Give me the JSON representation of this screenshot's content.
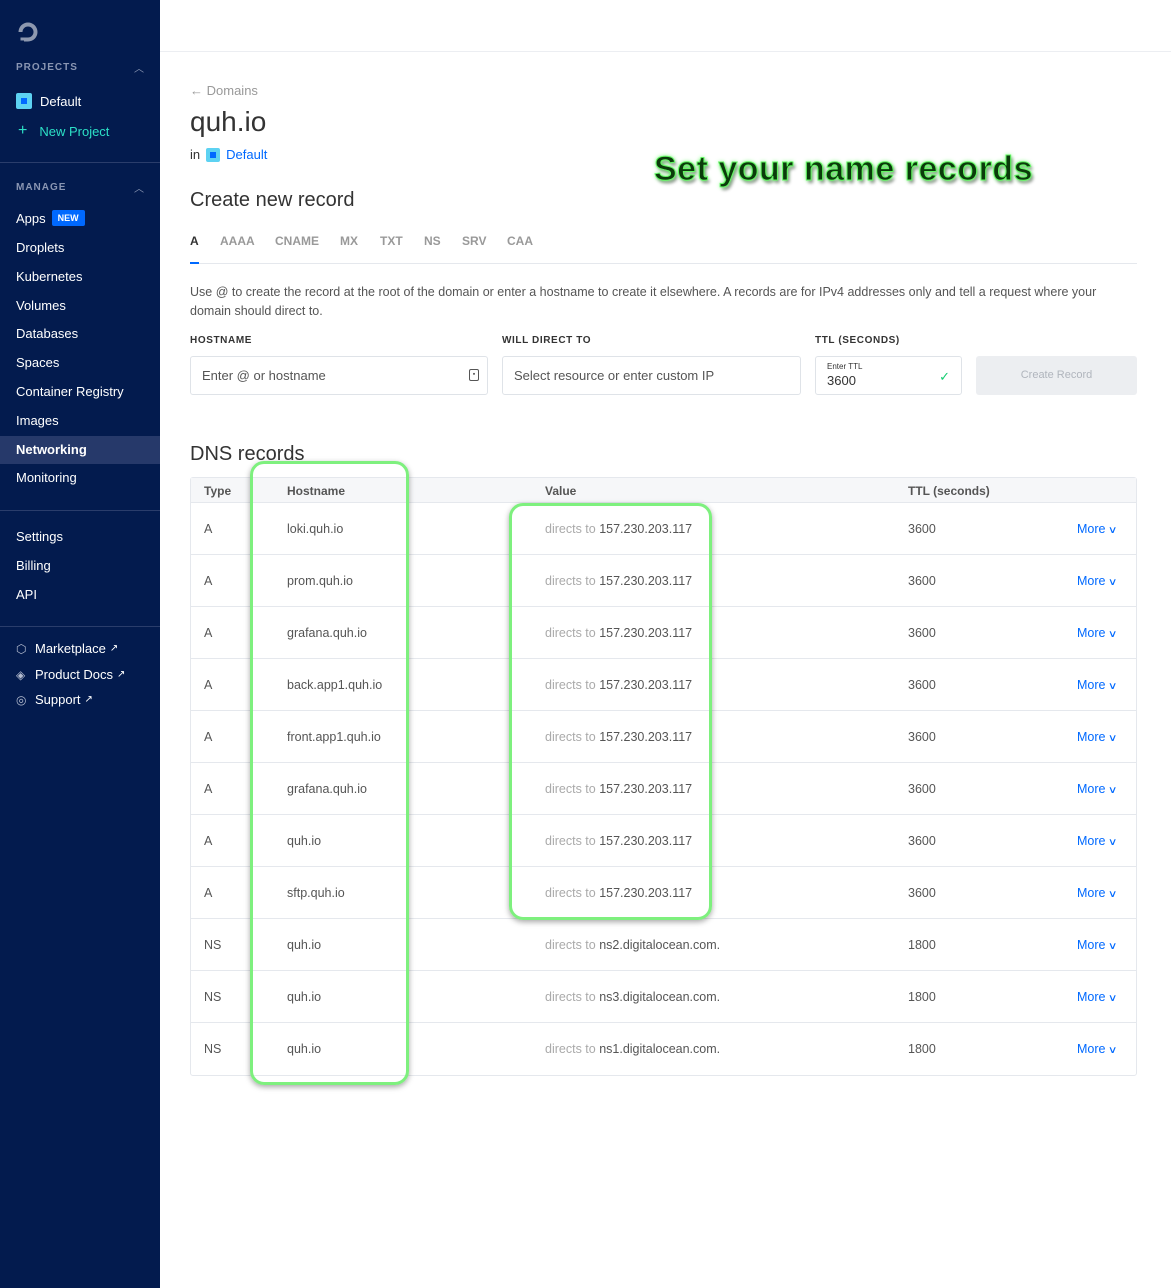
{
  "sidebar": {
    "projects_label": "PROJECTS",
    "projects": [
      {
        "label": "Default"
      },
      {
        "label": "New Project"
      }
    ],
    "manage_label": "MANAGE",
    "manage_items": [
      {
        "label": "Apps",
        "badge": "NEW"
      },
      {
        "label": "Droplets"
      },
      {
        "label": "Kubernetes"
      },
      {
        "label": "Volumes"
      },
      {
        "label": "Databases"
      },
      {
        "label": "Spaces"
      },
      {
        "label": "Container Registry"
      },
      {
        "label": "Images"
      },
      {
        "label": "Networking",
        "active": true
      },
      {
        "label": "Monitoring"
      }
    ],
    "account_items": [
      {
        "label": "Settings"
      },
      {
        "label": "Billing"
      },
      {
        "label": "API"
      }
    ],
    "external_items": [
      {
        "label": "Marketplace",
        "icon": "marketplace-icon"
      },
      {
        "label": "Product Docs",
        "icon": "docs-icon"
      },
      {
        "label": "Support",
        "icon": "support-icon"
      }
    ]
  },
  "header": {
    "breadcrumb": "Domains",
    "title": "quh.io",
    "in_label": "in",
    "project": "Default"
  },
  "annotation": "Set your name records",
  "create": {
    "heading": "Create new record",
    "tabs": [
      "A",
      "AAAA",
      "CNAME",
      "MX",
      "TXT",
      "NS",
      "SRV",
      "CAA"
    ],
    "active_tab": "A",
    "help": "Use @ to create the record at the root of the domain or enter a hostname to create it elsewhere. A records are for IPv4 addresses only and tell a request where your domain should direct to.",
    "hostname_label": "HOSTNAME",
    "hostname_placeholder": "Enter @ or hostname",
    "direct_label": "WILL DIRECT TO",
    "direct_placeholder": "Select resource or enter custom IP",
    "ttl_label": "TTL (SECONDS)",
    "ttl_small": "Enter TTL",
    "ttl_value": "3600",
    "button": "Create Record"
  },
  "dns": {
    "heading": "DNS records",
    "columns": [
      "Type",
      "Hostname",
      "Value",
      "TTL (seconds)"
    ],
    "directs_label": "directs to",
    "more_label": "More",
    "records": [
      {
        "type": "A",
        "hostname": "loki.quh.io",
        "value": "157.230.203.117",
        "ttl": "3600"
      },
      {
        "type": "A",
        "hostname": "prom.quh.io",
        "value": "157.230.203.117",
        "ttl": "3600"
      },
      {
        "type": "A",
        "hostname": "grafana.quh.io",
        "value": "157.230.203.117",
        "ttl": "3600"
      },
      {
        "type": "A",
        "hostname": "back.app1.quh.io",
        "value": "157.230.203.117",
        "ttl": "3600"
      },
      {
        "type": "A",
        "hostname": "front.app1.quh.io",
        "value": "157.230.203.117",
        "ttl": "3600"
      },
      {
        "type": "A",
        "hostname": "grafana.quh.io",
        "value": "157.230.203.117",
        "ttl": "3600"
      },
      {
        "type": "A",
        "hostname": "quh.io",
        "value": "157.230.203.117",
        "ttl": "3600"
      },
      {
        "type": "A",
        "hostname": "sftp.quh.io",
        "value": "157.230.203.117",
        "ttl": "3600"
      },
      {
        "type": "NS",
        "hostname": "quh.io",
        "value": "ns2.digitalocean.com.",
        "ttl": "1800"
      },
      {
        "type": "NS",
        "hostname": "quh.io",
        "value": "ns3.digitalocean.com.",
        "ttl": "1800"
      },
      {
        "type": "NS",
        "hostname": "quh.io",
        "value": "ns1.digitalocean.com.",
        "ttl": "1800"
      }
    ]
  },
  "colors": {
    "sidebar_bg": "#031b4e",
    "accent": "#0069ff",
    "highlight": "#7ef07e"
  }
}
